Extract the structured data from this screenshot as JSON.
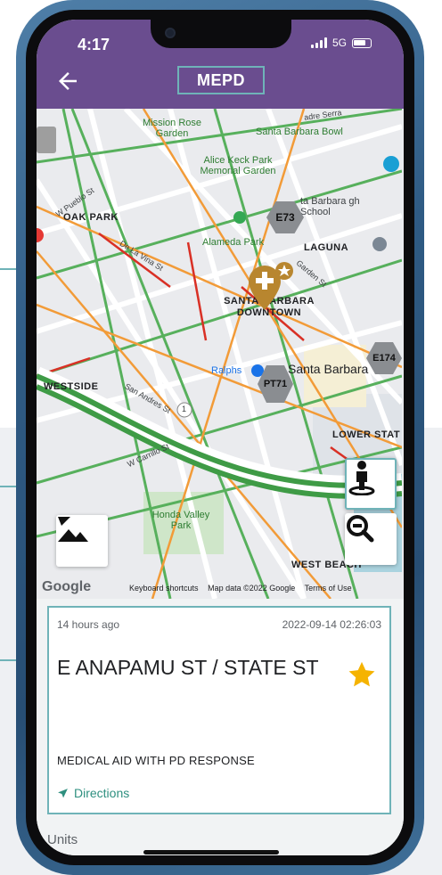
{
  "status_bar": {
    "time": "4:17",
    "network": "5G"
  },
  "header": {
    "title": "MEPD"
  },
  "icons": {
    "back": "arrow-left-icon",
    "responder": "person-standing-icon",
    "zoom_out": "magnifier-minus-icon",
    "terrain": "terrain-layer-icon",
    "star": "star-icon",
    "directions": "navigation-arrow-icon",
    "incident": "medical-incident-marker-icon"
  },
  "colors": {
    "header_bg": "#6a4d8f",
    "callout": "#6fb3b8",
    "star": "#f5b300",
    "directions": "#2e8f7f",
    "unit_marker": "#8a8d91",
    "incident_marker": "#b8862f"
  },
  "map": {
    "labels": {
      "mission_rose_garden": "Mission Rose Garden",
      "santa_barbara_bowl": "Santa Barbara Bowl",
      "alice_keck": "Alice Keck Park Memorial Garden",
      "oak_park": "OAK PARK",
      "sb_high_school": "ta Barbara gh School",
      "alameda_park": "Alameda Park",
      "laguna": "LAGUNA",
      "downtown": "SANTA BARBARA DOWNTOWN",
      "ralphs": "Ralphs",
      "santa_barbara": "Santa Barbara",
      "westside": "WESTSIDE",
      "lower_state": "LOWER STAT",
      "honda_valley_park": "Honda Valley Park",
      "west_beach": "WEST BEACH",
      "w_pueblo_st": "W Pueblo St",
      "de_la_vina_st": "De La Vina St",
      "garden_st": "Garden St",
      "san_andres_st": "San Andres St",
      "w_carrillo_st": "W Carrillo St",
      "route_1": "1",
      "sr_road": "adre Serra"
    },
    "units": [
      "E73",
      "E174",
      "PT71"
    ],
    "google": "Google",
    "attribution": [
      "Keyboard shortcuts",
      "Map data ©2022 Google",
      "Terms of Use"
    ]
  },
  "incident": {
    "time_ago": "14 hours ago",
    "timestamp": "2022-09-14 02:26:03",
    "address": "E ANAPAMU ST / STATE ST",
    "call_type": "MEDICAL AID WITH PD RESPONSE",
    "directions_label": "Directions",
    "starred": true
  },
  "units_section": {
    "label": "Units"
  }
}
